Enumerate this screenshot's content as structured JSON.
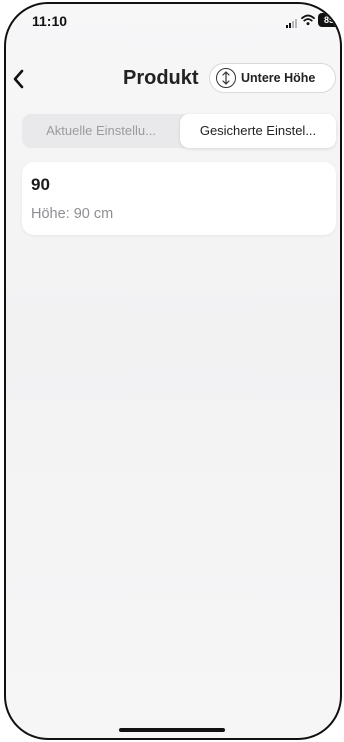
{
  "status_bar": {
    "time": "11:10",
    "battery": "85"
  },
  "nav": {
    "back_icon": "chevron-left-icon",
    "title": "Produkt",
    "height_button": {
      "icon": "vertical-arrows-circle-icon",
      "label": "Untere Höhe"
    }
  },
  "tabs": [
    {
      "label": "Aktuelle Einstellu...",
      "active": false
    },
    {
      "label": "Gesicherte Einstel...",
      "active": true
    }
  ],
  "items": [
    {
      "value": "90",
      "detail": "Höhe: 90 cm"
    }
  ]
}
